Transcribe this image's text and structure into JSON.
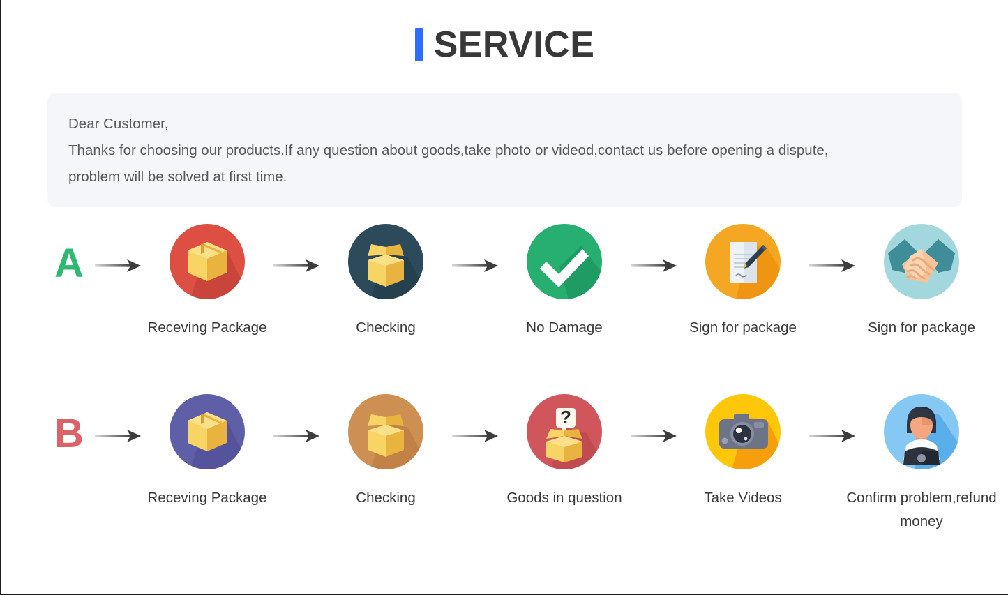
{
  "header": {
    "title": "SERVICE",
    "accent_bar_color": "#2b6eff",
    "title_color": "#383838"
  },
  "notice": {
    "background": "#f5f6f9",
    "text_color": "#59595e",
    "lines": [
      "Dear Customer,",
      "Thanks for choosing our products.If any question about goods,take photo or videod,contact us before opening a dispute,",
      "problem will be solved at first time."
    ]
  },
  "flow": {
    "rows": [
      {
        "letter": "A",
        "letter_color": "#2eb872",
        "steps": [
          {
            "label": "Receving Package",
            "icon": "closed-box-icon",
            "circle_color": "#de4f43"
          },
          {
            "label": "Checking",
            "icon": "open-box-icon",
            "circle_color": "#2c4a5a"
          },
          {
            "label": "No Damage",
            "icon": "check-mark-icon",
            "circle_color": "#27ae71"
          },
          {
            "label": "Sign for package",
            "icon": "document-pen-icon",
            "circle_color": "#f5a623"
          },
          {
            "label": "Sign for package",
            "icon": "handshake-icon",
            "circle_color": "#a2d8dd"
          }
        ]
      },
      {
        "letter": "B",
        "letter_color": "#db6368",
        "steps": [
          {
            "label": "Receving Package",
            "icon": "closed-box-icon",
            "circle_color": "#5f5fa8"
          },
          {
            "label": "Checking",
            "icon": "open-box-icon",
            "circle_color": "#ce8f52"
          },
          {
            "label": "Goods in question",
            "icon": "question-box-icon",
            "circle_color": "#d1565c"
          },
          {
            "label": "Take Videos",
            "icon": "camera-icon",
            "circle_color": "#ffc709"
          },
          {
            "label": "Confirm problem,refund money",
            "icon": "support-agent-icon",
            "circle_color": "#86c8f4"
          }
        ]
      }
    ],
    "arrow_icon": "arrow-right-icon",
    "arrow_color": "#3d3d3d"
  }
}
